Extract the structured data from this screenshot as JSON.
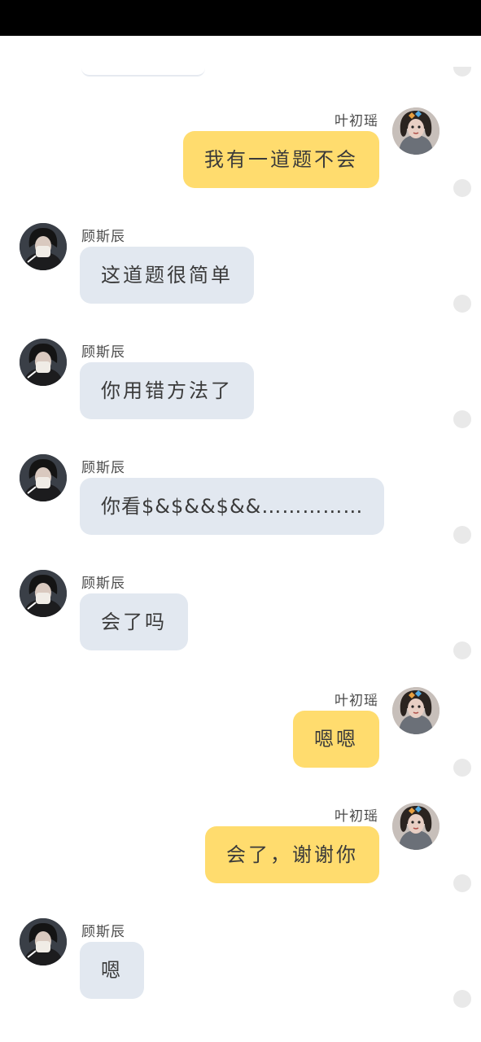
{
  "users": {
    "me": {
      "name": "叶初瑶"
    },
    "other": {
      "name": "顾斯辰"
    }
  },
  "messages": [
    {
      "sender": "me",
      "name": "叶初瑶",
      "text": "我有一道题不会"
    },
    {
      "sender": "other",
      "name": "顾斯辰",
      "text": "这道题很简单"
    },
    {
      "sender": "other",
      "name": "顾斯辰",
      "text": "你用错方法了"
    },
    {
      "sender": "other",
      "name": "顾斯辰",
      "text": "你看$&$&&$&&……………"
    },
    {
      "sender": "other",
      "name": "顾斯辰",
      "text": "会了吗"
    },
    {
      "sender": "me",
      "name": "叶初瑶",
      "text": "嗯嗯"
    },
    {
      "sender": "me",
      "name": "叶初瑶",
      "text": "会了，谢谢你"
    },
    {
      "sender": "other",
      "name": "顾斯辰",
      "text": "嗯"
    }
  ],
  "colors": {
    "my_bubble": "#ffdc6e",
    "other_bubble": "#e2e8f0",
    "status_bar": "#000000"
  }
}
